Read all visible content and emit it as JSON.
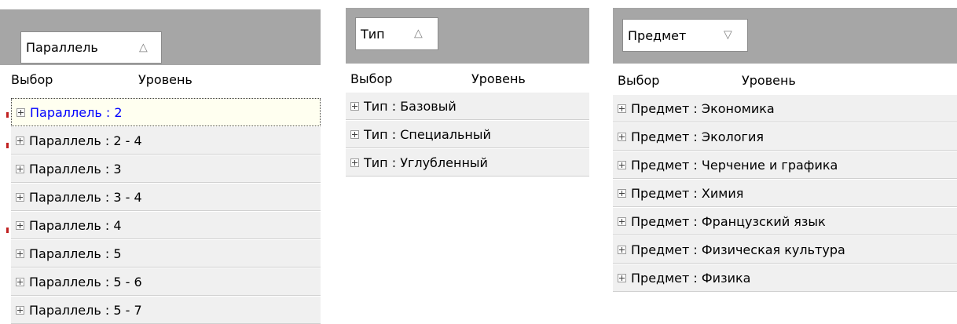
{
  "panels": [
    {
      "group_chip": "Параллель",
      "sort_icon": "△",
      "columns": [
        "Выбор",
        "Уровень"
      ],
      "rows": [
        {
          "text": "Параллель : 2",
          "selected": true
        },
        {
          "text": "Параллель : 2 - 4"
        },
        {
          "text": "Параллель : 3"
        },
        {
          "text": "Параллель : 3 - 4"
        },
        {
          "text": "Параллель : 4"
        },
        {
          "text": "Параллель : 5"
        },
        {
          "text": "Параллель : 5 - 6"
        },
        {
          "text": "Параллель : 5 - 7"
        }
      ]
    },
    {
      "group_chip": "Тип",
      "sort_icon": "△",
      "columns": [
        "Выбор",
        "Уровень"
      ],
      "rows": [
        {
          "text": "Тип : Базовый"
        },
        {
          "text": "Тип : Специальный"
        },
        {
          "text": "Тип : Углубленный"
        }
      ]
    },
    {
      "group_chip": "Предмет",
      "sort_icon": "▽",
      "columns": [
        "Выбор",
        "Уровень"
      ],
      "rows": [
        {
          "text": "Предмет : Экономика"
        },
        {
          "text": "Предмет : Экология"
        },
        {
          "text": "Предмет : Черчение и графика"
        },
        {
          "text": "Предмет : Химия"
        },
        {
          "text": "Предмет : Французский язык"
        },
        {
          "text": "Предмет : Физическая культура"
        },
        {
          "text": "Предмет : Физика"
        }
      ]
    }
  ],
  "icons": {
    "expander": "plus-box-icon",
    "sort_ascending": "sort-ascending-icon",
    "sort_descending": "sort-descending-icon"
  },
  "colors": {
    "group_area": "#a6a6a6",
    "row_background": "#f0f0f0",
    "selected_text": "#0000ff",
    "selected_background": "#fffff0"
  }
}
